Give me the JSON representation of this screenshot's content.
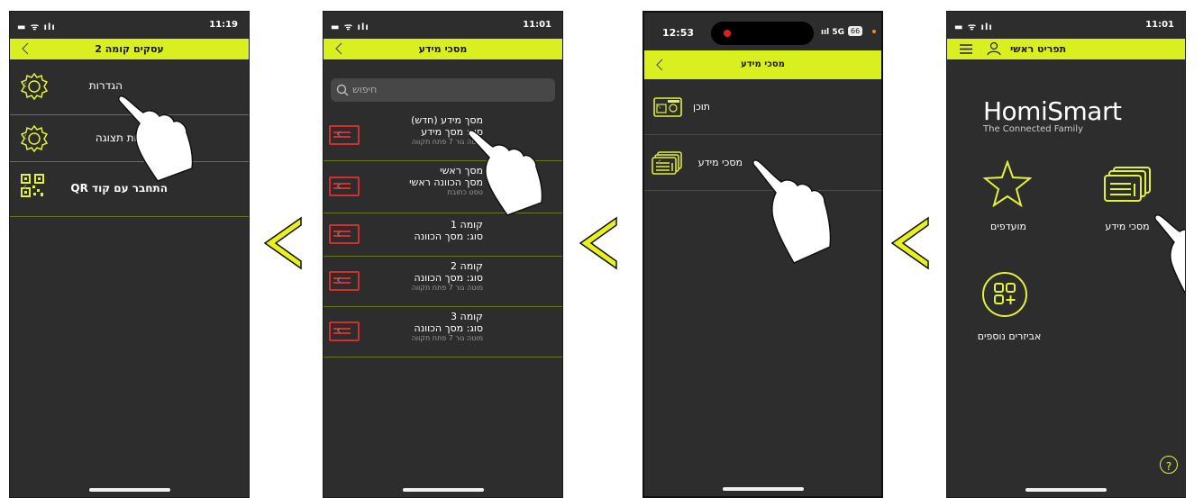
{
  "screens": [
    {
      "status_left": "▬ ᯤ ılı",
      "time": "11:19",
      "title": "עסקים קומה 2",
      "rows": [
        {
          "label": "הגדרות"
        },
        {
          "label": "הגדרות תצוגה"
        },
        {
          "label": "התחבר עם קוד QR"
        }
      ]
    },
    {
      "status_left": "▬ ᯤ ılı",
      "time": "11:01",
      "title": "מסכי מידע",
      "search_placeholder": "חיפוש",
      "items": [
        {
          "title": "מסך מידע (חדש)",
          "type": "סוג: מסך מידע",
          "note": "מוטה גור 7 פתח תקווה"
        },
        {
          "title": "מסך ראשי",
          "type": "מסך הכוונה ראשי",
          "note": "טסט כתובת"
        },
        {
          "title": "קומה 1",
          "type": "סוג: מסך הכוונה",
          "note": ""
        },
        {
          "title": "קומה 2",
          "type": "סוג: מסך הכוונה",
          "note": "מוטה גור 7 פתח תקווה"
        },
        {
          "title": "קומה 3",
          "type": "סוג: מסך הכוונה",
          "note": "מוטה גור 7 פתח תקווה"
        }
      ]
    },
    {
      "time": "12:53",
      "status_right": "ııl 5G",
      "battery": "66",
      "title": "מסכי מידע",
      "rows": [
        {
          "label": "תוכן"
        },
        {
          "label": "מסכי מידע"
        }
      ]
    },
    {
      "status_left": "▬ ᯤ ılı",
      "time": "11:01",
      "title": "תפריט ראשי",
      "logo_main": "HomiSmart",
      "logo_sub": "The Connected Family",
      "tiles": [
        {
          "label": "מסכי מידע"
        },
        {
          "label": "מועדפים"
        },
        {
          "label": "אביזרים נוספים"
        }
      ],
      "help": "?"
    }
  ],
  "colors": {
    "accent": "#d9ef1f",
    "background": "#2d2d2d",
    "red": "#d23030"
  }
}
